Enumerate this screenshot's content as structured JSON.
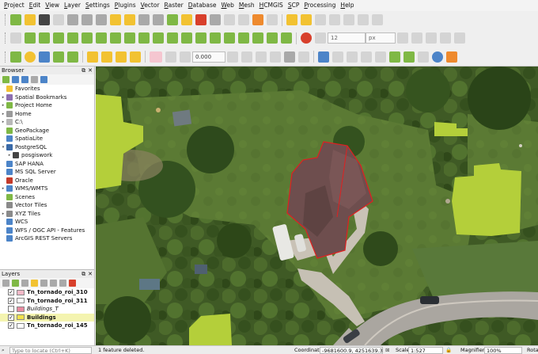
{
  "menu": [
    "Project",
    "Edit",
    "View",
    "Layer",
    "Settings",
    "Plugins",
    "Vector",
    "Raster",
    "Database",
    "Web",
    "Mesh",
    "HCMGIS",
    "SCP",
    "Processing",
    "Help"
  ],
  "toolbar2": {
    "font_size_value": "12",
    "unit_value": "px"
  },
  "toolbar3": {
    "number_value": "0.000"
  },
  "browser": {
    "title": "Browser",
    "items": [
      {
        "label": "Favorites",
        "arrow": "",
        "icon_color": "#f2c232"
      },
      {
        "label": "Spatial Bookmarks",
        "arrow": "▸",
        "icon_color": "#8d6fb0"
      },
      {
        "label": "Project Home",
        "arrow": "▸",
        "icon_color": "#7fb845"
      },
      {
        "label": "Home",
        "arrow": "▸",
        "icon_color": "#9a9a9a"
      },
      {
        "label": "C:\\",
        "arrow": "▸",
        "icon_color": "#b8b8b8"
      },
      {
        "label": "GeoPackage",
        "arrow": "",
        "icon_color": "#7fb845"
      },
      {
        "label": "SpatiaLite",
        "arrow": "",
        "icon_color": "#4c84c8"
      },
      {
        "label": "PostgreSQL",
        "arrow": "▾",
        "icon_color": "#3a6aa8"
      },
      {
        "label": "posgiswork",
        "arrow": "▸",
        "icon_color": "#444444",
        "indent": true
      },
      {
        "label": "SAP HANA",
        "arrow": "",
        "icon_color": "#4c84c8"
      },
      {
        "label": "MS SQL Server",
        "arrow": "",
        "icon_color": "#4c84c8"
      },
      {
        "label": "Oracle",
        "arrow": "",
        "icon_color": "#c43a2a"
      },
      {
        "label": "WMS/WMTS",
        "arrow": "▸",
        "icon_color": "#4c84c8"
      },
      {
        "label": "Scenes",
        "arrow": "",
        "icon_color": "#7fb845"
      },
      {
        "label": "Vector Tiles",
        "arrow": "",
        "icon_color": "#8a8a8a"
      },
      {
        "label": "XYZ Tiles",
        "arrow": "▸",
        "icon_color": "#8a8a8a"
      },
      {
        "label": "WCS",
        "arrow": "",
        "icon_color": "#4c84c8"
      },
      {
        "label": "WFS / OGC API - Features",
        "arrow": "",
        "icon_color": "#4c84c8"
      },
      {
        "label": "ArcGIS REST Servers",
        "arrow": "",
        "icon_color": "#4c84c8"
      }
    ]
  },
  "layers": {
    "title": "Layers",
    "items": [
      {
        "label": "Tn_tornado_roi_310",
        "checked": true,
        "swatch": "#f3b9c8",
        "style": "bold"
      },
      {
        "label": "Tn_tornado_roi_311",
        "checked": true,
        "swatch": "#ffffff",
        "style": "bold"
      },
      {
        "label": "Buildings_T",
        "checked": false,
        "swatch": "#e88aa0",
        "style": "italic"
      },
      {
        "label": "Buildings",
        "checked": true,
        "swatch": "#f2e24a",
        "style": "bold-selected"
      },
      {
        "label": "Tn_tornado_roi_145",
        "checked": true,
        "swatch": "#ffffff",
        "style": "bold"
      }
    ]
  },
  "status": {
    "search_placeholder": "Type to locate (Ctrl+K)",
    "message": "1 feature deleted.",
    "coordinate_label": "Coordinate",
    "coordinate_value": "-9681600.9, 4251639.3",
    "scale_label": "Scale",
    "scale_value": "1:527",
    "magnifier_label": "Magnifier",
    "magnifier_value": "100%",
    "rotation_label": "Rota"
  }
}
